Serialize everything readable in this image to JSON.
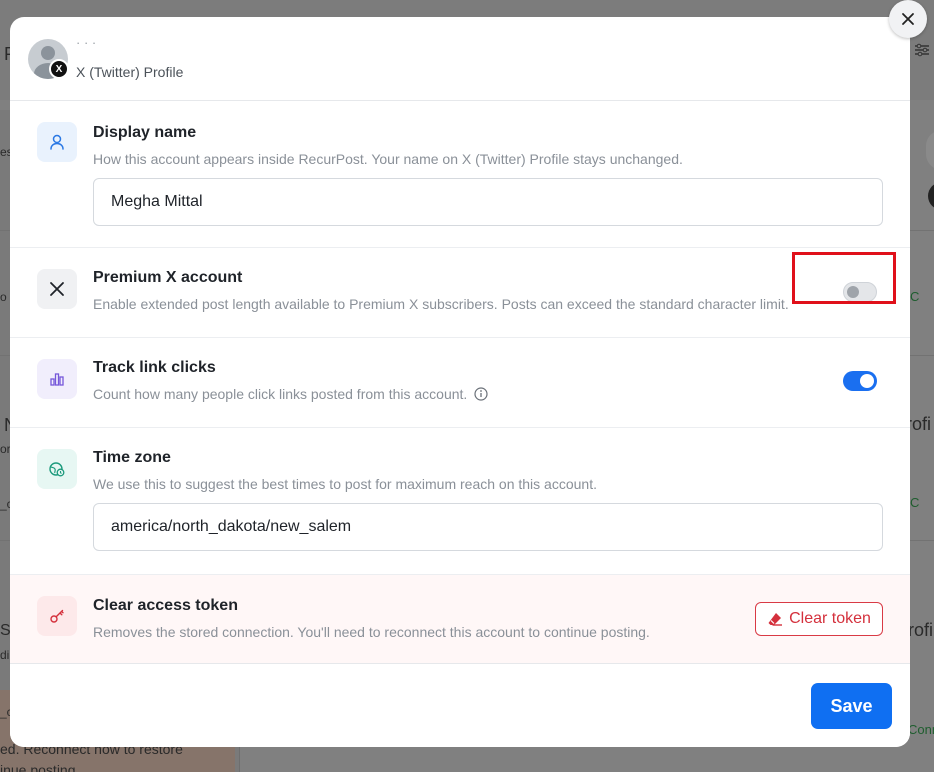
{
  "background": {
    "top_left_text": "P",
    "left_fragments": [
      "es",
      "o",
      "N",
      "or",
      "_c",
      "S",
      "di",
      "_c"
    ],
    "right_fragments": [
      "rofi",
      "rofi"
    ],
    "status_label": "C",
    "status_label_long": "Conn",
    "bottom_notice_line1": "ed. Reconnect now to restore",
    "bottom_notice_line2": "inue posting."
  },
  "header": {
    "profile_name": "· · ·",
    "profile_type": "X (Twitter) Profile",
    "badge_letter": "X"
  },
  "display_name": {
    "title": "Display name",
    "description": "How this account appears inside RecurPost. Your name on X (Twitter) Profile stays unchanged.",
    "value": "Megha Mittal"
  },
  "premium": {
    "title": "Premium X account",
    "description": "Enable extended post length available to Premium X subscribers. Posts can exceed the standard character limit.",
    "enabled": false
  },
  "track_clicks": {
    "title": "Track link clicks",
    "description": "Count how many people click links posted from this account.",
    "enabled": true
  },
  "timezone": {
    "title": "Time zone",
    "description": "We use this to suggest the best times to post for maximum reach on this account.",
    "value": "america/north_dakota/new_salem"
  },
  "clear_token": {
    "title": "Clear access token",
    "description": "Removes the stored connection. You'll need to reconnect this account to continue posting.",
    "button_label": "Clear token"
  },
  "footer": {
    "save_label": "Save"
  },
  "colors": {
    "primary": "#0f6ff2",
    "danger": "#d4303c",
    "highlight": "#e0101a"
  }
}
